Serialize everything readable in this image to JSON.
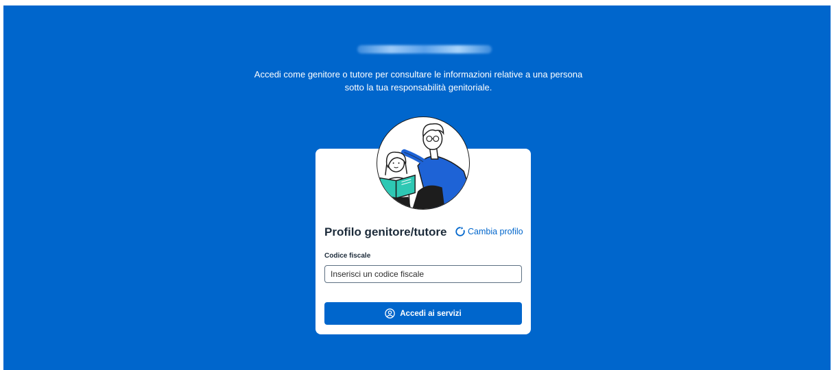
{
  "intro_text": "Accedi come genitore o tutore per consultare le informazioni relative a una persona sotto la tua responsabilità genitoriale.",
  "card": {
    "title": "Profilo genitore/tutore",
    "change_profile_label": "Cambia profilo",
    "field_label": "Codice fiscale",
    "field_placeholder": "Inserisci un codice fiscale",
    "field_value": "",
    "submit_label": "Accedi ai servizi"
  },
  "icons": {
    "change_profile": "refresh-icon",
    "submit": "user-circle-icon",
    "illustration": "parent-child-reading-illustration"
  },
  "colors": {
    "background": "#0066cc",
    "primary": "#0066cc",
    "card": "#ffffff",
    "text_dark": "#1c2b3a"
  }
}
